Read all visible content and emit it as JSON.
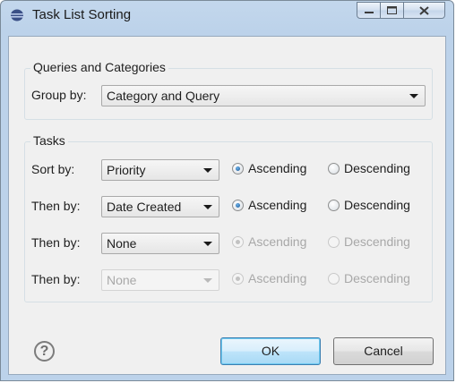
{
  "window": {
    "title": "Task List Sorting"
  },
  "queries_group": {
    "label": "Queries and Categories",
    "group_by_label": "Group by:",
    "group_by_value": "Category and Query"
  },
  "tasks_group": {
    "label": "Tasks",
    "rows": [
      {
        "label": "Sort by:",
        "value": "Priority",
        "ascending": "Ascending",
        "descending": "Descending",
        "enabled": true
      },
      {
        "label": "Then by:",
        "value": "Date Created",
        "ascending": "Ascending",
        "descending": "Descending",
        "enabled": true
      },
      {
        "label": "Then by:",
        "value": "None",
        "ascending": "Ascending",
        "descending": "Descending",
        "enabled": true
      },
      {
        "label": "Then by:",
        "value": "None",
        "ascending": "Ascending",
        "descending": "Descending",
        "enabled": false
      }
    ]
  },
  "buttons": {
    "help": "?",
    "ok": "OK",
    "cancel": "Cancel"
  }
}
